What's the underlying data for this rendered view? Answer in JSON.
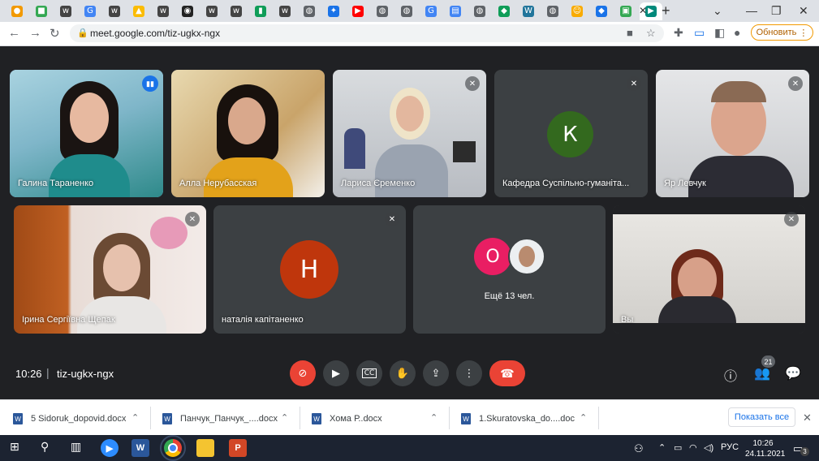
{
  "browser": {
    "url": "meet.google.com/tiz-ugkx-ngx",
    "update_label": "Обновить",
    "tabs": [
      {
        "icon": "bulb-icon",
        "color": "#f29900"
      },
      {
        "icon": "green-book-icon",
        "color": "#34a853"
      },
      {
        "icon": "wolf-icon",
        "color": "#444"
      },
      {
        "icon": "google-icon",
        "color": "#4285f4"
      },
      {
        "icon": "wolf-icon",
        "color": "#444"
      },
      {
        "icon": "drive-icon",
        "color": "#fbbc04"
      },
      {
        "icon": "wolf-icon",
        "color": "#444"
      },
      {
        "icon": "bear-icon",
        "color": "#222"
      },
      {
        "icon": "wolf-icon",
        "color": "#444"
      },
      {
        "icon": "wolf-icon",
        "color": "#444"
      },
      {
        "icon": "chart-icon",
        "color": "#0f9d58"
      },
      {
        "icon": "wolf-icon",
        "color": "#444"
      },
      {
        "icon": "globe-icon",
        "color": "#5f6368"
      },
      {
        "icon": "puzzle-icon",
        "color": "#1a73e8"
      },
      {
        "icon": "youtube-icon",
        "color": "#ff0000"
      },
      {
        "icon": "globe-icon",
        "color": "#5f6368"
      },
      {
        "icon": "globe-icon",
        "color": "#5f6368"
      },
      {
        "icon": "google-icon",
        "color": "#4285f4"
      },
      {
        "icon": "doc-icon",
        "color": "#4285f4"
      },
      {
        "icon": "globe-icon",
        "color": "#5f6368"
      },
      {
        "icon": "shield-icon",
        "color": "#0f9d58"
      },
      {
        "icon": "wordpress-icon",
        "color": "#21759b"
      },
      {
        "icon": "globe-icon",
        "color": "#5f6368"
      },
      {
        "icon": "smiley-icon",
        "color": "#f9ab00"
      },
      {
        "icon": "diamond-icon",
        "color": "#1a73e8"
      },
      {
        "icon": "shop-icon",
        "color": "#34a853"
      },
      {
        "icon": "meet-icon",
        "color": "#00897b"
      }
    ]
  },
  "meeting": {
    "time": "10:26",
    "code": "tiz-ugkx-ngx",
    "participant_count": "21",
    "participants": [
      {
        "name": "Галина Тараненко",
        "bg": "#7fb6c9",
        "speaking": true
      },
      {
        "name": "Алла Нерубасская",
        "bg": "#c9a46a"
      },
      {
        "name": "Лариса Єременко",
        "bg": "#b8bcc2"
      },
      {
        "name": "Кафедра Суспільно-гуманіта...",
        "initial": "К",
        "avatar_color": "#33691e"
      },
      {
        "name": "Яр Левчук",
        "bg": "#c7c9cc"
      },
      {
        "name": "Ірина Сергіївна Щепак",
        "bg": "#c9b8b0"
      },
      {
        "name": "наталія капітаненко",
        "initial": "Н",
        "avatar_color": "#bf360c"
      },
      {
        "name": "Ещё 13 чел.",
        "initial": "О",
        "avatar_color": "#e91e63"
      },
      {
        "name": "Вы",
        "bg": "#dcdad6"
      }
    ]
  },
  "downloads": {
    "items": [
      "5 Sidoruk_dopovid.docx",
      "Панчук_Панчук_....docx",
      "Хома Р..docx",
      "1.Skuratovska_do....doc"
    ],
    "show_all": "Показать все"
  },
  "taskbar": {
    "lang": "РУС",
    "time": "10:26",
    "date": "24.11.2021",
    "notifications": "3"
  }
}
